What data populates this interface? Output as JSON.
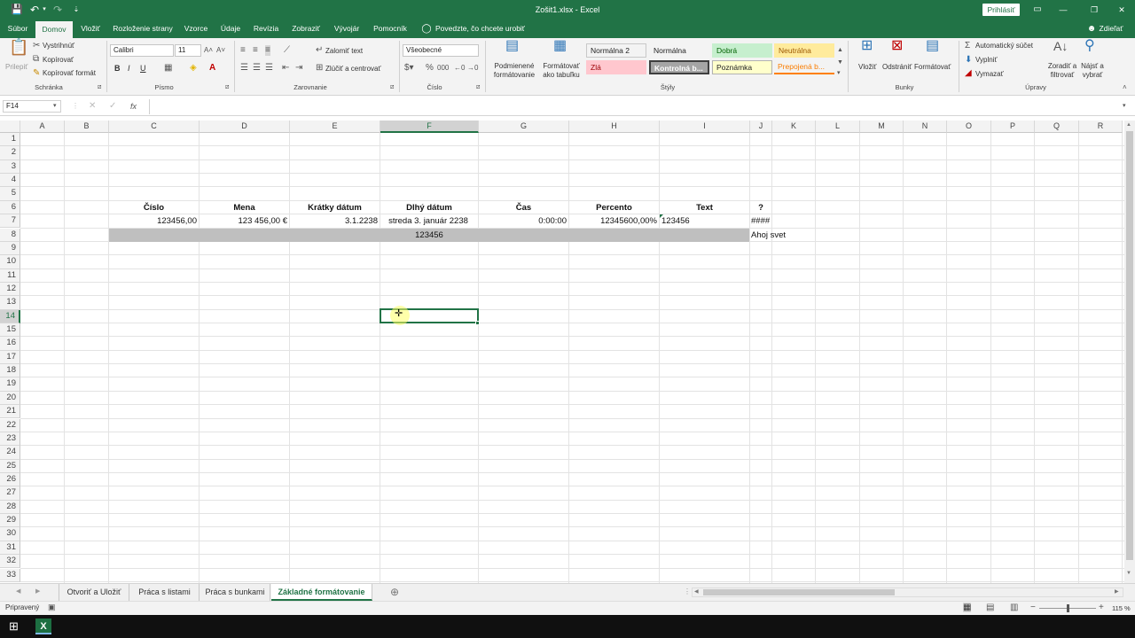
{
  "titlebar": {
    "title": "Zošit1.xlsx  -  Excel",
    "signin": "Prihlásiť",
    "min": "—",
    "restore": "❐",
    "max": "▢",
    "close": "✕"
  },
  "menubar": {
    "items": [
      "Súbor",
      "Domov",
      "Vložiť",
      "Rozloženie strany",
      "Vzorce",
      "Údaje",
      "Revízia",
      "Zobraziť",
      "Vývojár",
      "Pomocník"
    ],
    "tellme": "Povedzte, čo chcete urobiť",
    "share": "Zdieľať"
  },
  "ribbon": {
    "clipboard": {
      "paste": "Prilepiť",
      "cut": "Vystrihnúť",
      "copy": "Kopírovať",
      "format_painter": "Kopírovať formát",
      "group": "Schránka"
    },
    "font": {
      "name": "Calibri",
      "size": "11",
      "bold": "B",
      "italic": "I",
      "underline": "U",
      "group": "Písmo"
    },
    "alignment": {
      "wrap": "Zalomiť text",
      "merge": "Zlúčiť a centrovať",
      "group": "Zarovnanie"
    },
    "number": {
      "format": "Všeobecné",
      "group": "Číslo"
    },
    "styles": {
      "conditional": "Podmienené formátovanie",
      "as_table": "Formátovať ako tabuľku",
      "group": "Štýly",
      "cells": [
        {
          "label": "Normálna 2",
          "bg": "#ffffff",
          "fg": "#000000"
        },
        {
          "label": "Normálna",
          "bg": "#ffffff",
          "fg": "#000000"
        },
        {
          "label": "Dobrá",
          "bg": "#c6efce",
          "fg": "#006100"
        },
        {
          "label": "Neutrálna",
          "bg": "#ffeb9c",
          "fg": "#9c5700"
        },
        {
          "label": "Zlá",
          "bg": "#ffc7ce",
          "fg": "#9c0006"
        },
        {
          "label": "Kontrolná b...",
          "bg": "#a5a5a5",
          "fg": "#ffffff"
        },
        {
          "label": "Poznámka",
          "bg": "#ffffcc",
          "fg": "#000000"
        },
        {
          "label": "Prepojená b...",
          "bg": "#ffffff",
          "fg": "#fa7d00"
        }
      ]
    },
    "cells": {
      "insert": "Vložiť",
      "delete": "Odstrániť",
      "format": "Formátovať",
      "group": "Bunky"
    },
    "editing": {
      "autosum": "Automatický súčet",
      "fill": "Vyplniť",
      "clear": "Vymazať",
      "sort": "Zoradiť a filtrovať",
      "find": "Nájsť a vybrať",
      "group": "Úpravy"
    }
  },
  "formulabar": {
    "namebox": "F14",
    "cancel": "✕",
    "enter": "✓",
    "fx": "fx",
    "content": ""
  },
  "columns": [
    "A",
    "B",
    "C",
    "D",
    "E",
    "F",
    "G",
    "H",
    "I",
    "J",
    "K",
    "L",
    "M",
    "N",
    "O",
    "P",
    "Q",
    "R"
  ],
  "rows": [
    "1",
    "2",
    "3",
    "4",
    "5",
    "6",
    "7",
    "8",
    "9",
    "10",
    "11",
    "12",
    "13",
    "14",
    "15",
    "16",
    "17",
    "18",
    "19",
    "20",
    "21",
    "22",
    "23",
    "24",
    "25",
    "26",
    "27",
    "28",
    "29",
    "30",
    "31",
    "32",
    "33"
  ],
  "headers": {
    "c": "Číslo",
    "d": "Mena",
    "e": "Krátky dátum",
    "f": "Dlhý dátum",
    "g": "Čas",
    "h": "Percento",
    "i": "Text",
    "j": "?"
  },
  "row7": {
    "c": "123456,00",
    "d": "123 456,00 €",
    "e": "3.1.2238",
    "f": "streda 3. január 2238",
    "g": "0:00:00",
    "h": "12345600,00%",
    "i": "123456",
    "j": "####"
  },
  "row8": {
    "merged": "123456",
    "j": "Ahoj svet",
    "fill": "#bfbfbf"
  },
  "selected_cell": "F14",
  "sheets": [
    "Otvoriť a Uložiť",
    "Práca s listami",
    "Práca s bunkami",
    "Základné formátovanie"
  ],
  "active_sheet": "Základné formátovanie",
  "status": {
    "ready": "Pripravený",
    "zoom": "115 %"
  },
  "accent": "#217346"
}
